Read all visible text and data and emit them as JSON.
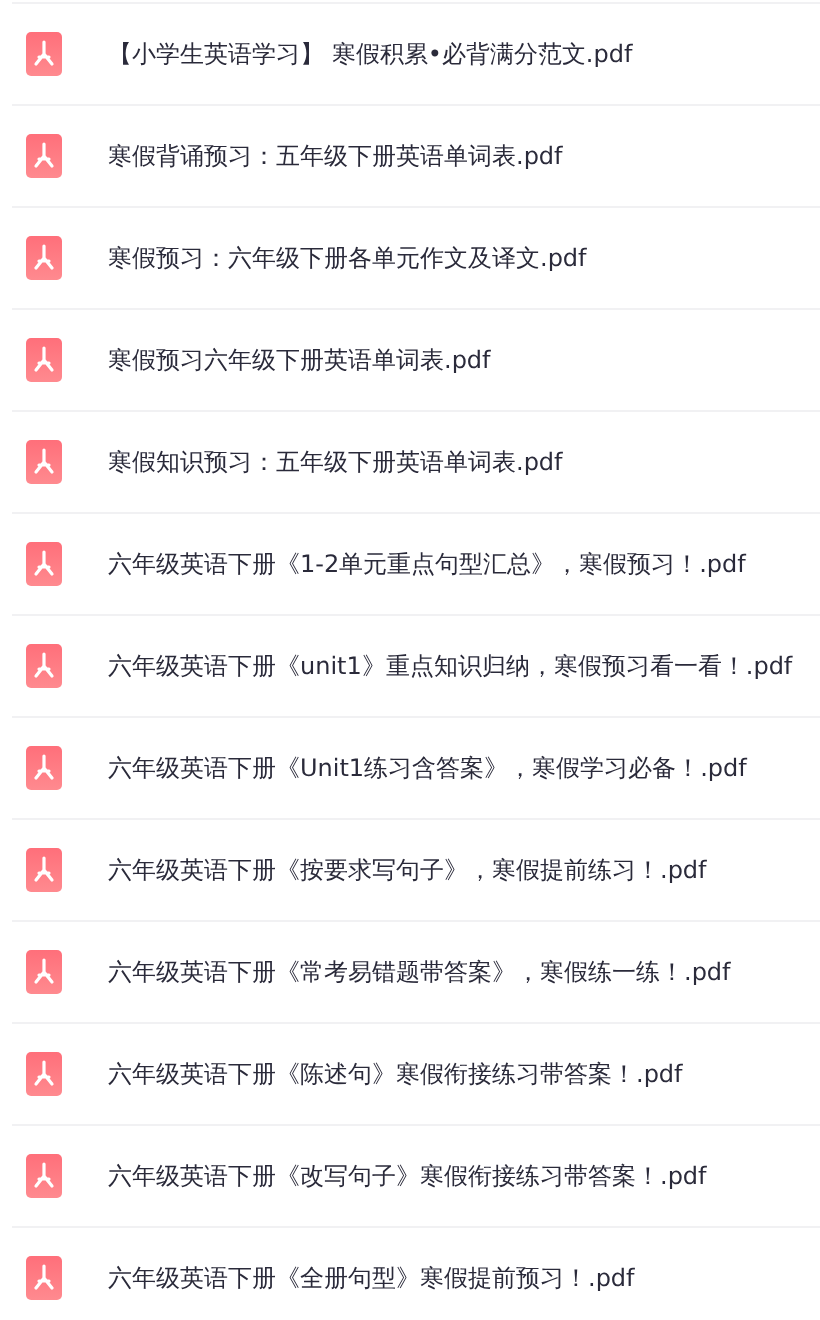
{
  "files": [
    {
      "name": "【小学生英语学习】 寒假积累•必背满分范文.pdf"
    },
    {
      "name": "寒假背诵预习：五年级下册英语单词表.pdf"
    },
    {
      "name": "寒假预习：六年级下册各单元作文及译文.pdf"
    },
    {
      "name": "寒假预习六年级下册英语单词表.pdf"
    },
    {
      "name": "寒假知识预习：五年级下册英语单词表.pdf"
    },
    {
      "name": "六年级英语下册《1-2单元重点句型汇总》，寒假预习！.pdf"
    },
    {
      "name": "六年级英语下册《unit1》重点知识归纳，寒假预习看一看！.pdf"
    },
    {
      "name": "六年级英语下册《Unit1练习含答案》，寒假学习必备！.pdf"
    },
    {
      "name": "六年级英语下册《按要求写句子》，寒假提前练习！.pdf"
    },
    {
      "name": "六年级英语下册《常考易错题带答案》，寒假练一练！.pdf"
    },
    {
      "name": "六年级英语下册《陈述句》寒假衔接练习带答案！.pdf"
    },
    {
      "name": "六年级英语下册《改写句子》寒假衔接练习带答案！.pdf"
    },
    {
      "name": "六年级英语下册《全册句型》寒假提前预习！.pdf"
    }
  ]
}
